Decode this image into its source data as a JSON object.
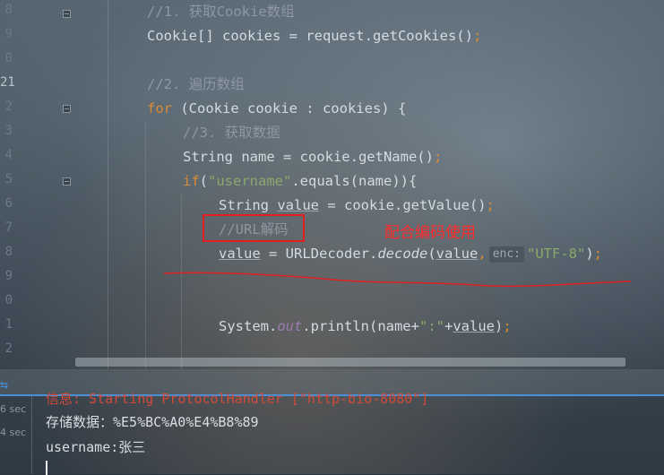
{
  "editor": {
    "gutter": [
      "8",
      "9",
      "0",
      "21",
      "2",
      "3",
      "4",
      "5",
      "6",
      "7",
      "8",
      "9",
      "0",
      "1",
      "2"
    ],
    "comment1": "//1. 获取Cookie数组",
    "line_cookies_type": "Cookie[]",
    "line_cookies_rest": " cookies = request.getCookies()",
    "comment2": "//2. 遍历数组",
    "for_kw": "for",
    "for_rest": " (Cookie cookie : cookies) {",
    "comment3": "//3. 获取数据",
    "name_decl": "String name = cookie.getName()",
    "if_kw": "if",
    "if_open": "(",
    "if_str": "\"username\"",
    "if_rest": ".equals(name)){",
    "value_decl_a": "String ",
    "value_decl_var": "value",
    "value_decl_b": " = cookie.getValue()",
    "comment_url": "//URL解码",
    "decode_var": "value",
    "decode_mid": " = URLDecoder.",
    "decode_method": "decode",
    "decode_paren": "(",
    "decode_arg": "value",
    "decode_comma": ",",
    "decode_hint": "enc:",
    "decode_str": "\"UTF-8\"",
    "decode_close": ")",
    "println_a": "System.",
    "println_out": "out",
    "println_b": ".println(name+",
    "println_str": "\":\"",
    "println_plus": "+",
    "println_var": "value",
    "println_close": ")",
    "semicolon": ";"
  },
  "annotation": {
    "label": "配合编码使用",
    "color": "#ff2a2a"
  },
  "console": {
    "tab_icon": "arrow-icon",
    "timestamps": [
      "6 sec",
      "4 sec"
    ],
    "lines": [
      "信息: Starting ProtocolHandler [\"http-bio-8080\"]",
      "存储数据：%E5%BC%A0%E4%B8%89",
      "username:张三"
    ]
  },
  "colors": {
    "keyword": "#d98b36",
    "string": "#8aa86a",
    "comment": "#8d98a3",
    "static_field": "#9d7bb0",
    "accent": "#4a90d9"
  }
}
